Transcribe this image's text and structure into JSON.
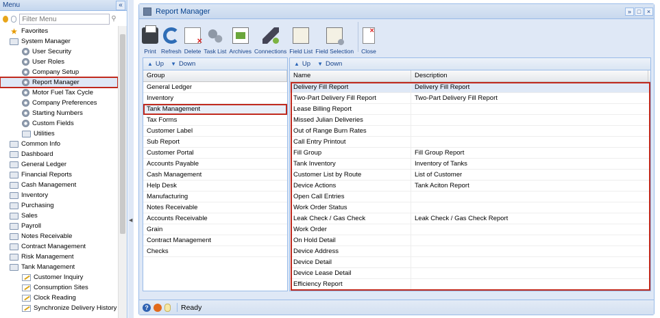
{
  "sidebar": {
    "title": "Menu",
    "collapse_glyph": "«",
    "filter_placeholder": "Filter Menu",
    "items": [
      {
        "label": "Favorites",
        "icon": "star-icon",
        "level": 0
      },
      {
        "label": "System Manager",
        "icon": "folder-icon",
        "level": 0
      },
      {
        "label": "User Security",
        "icon": "gear-icon",
        "level": 1
      },
      {
        "label": "User Roles",
        "icon": "gear-icon",
        "level": 1
      },
      {
        "label": "Company Setup",
        "icon": "gear-icon",
        "level": 1
      },
      {
        "label": "Report Manager",
        "icon": "gear-icon",
        "level": 1,
        "selected": true
      },
      {
        "label": "Motor Fuel Tax Cycle",
        "icon": "gear-icon",
        "level": 1
      },
      {
        "label": "Company Preferences",
        "icon": "gear-icon",
        "level": 1
      },
      {
        "label": "Starting Numbers",
        "icon": "gear-icon",
        "level": 1
      },
      {
        "label": "Custom Fields",
        "icon": "gear-icon",
        "level": 1
      },
      {
        "label": "Utilities",
        "icon": "folder-icon",
        "level": 1
      },
      {
        "label": "Common Info",
        "icon": "folder-icon",
        "level": 0
      },
      {
        "label": "Dashboard",
        "icon": "folder-icon",
        "level": 0
      },
      {
        "label": "General Ledger",
        "icon": "folder-icon",
        "level": 0
      },
      {
        "label": "Financial Reports",
        "icon": "folder-icon",
        "level": 0
      },
      {
        "label": "Cash Management",
        "icon": "folder-icon",
        "level": 0
      },
      {
        "label": "Inventory",
        "icon": "folder-icon",
        "level": 0
      },
      {
        "label": "Purchasing",
        "icon": "folder-icon",
        "level": 0
      },
      {
        "label": "Sales",
        "icon": "folder-icon",
        "level": 0
      },
      {
        "label": "Payroll",
        "icon": "folder-icon",
        "level": 0
      },
      {
        "label": "Notes Receivable",
        "icon": "folder-icon",
        "level": 0
      },
      {
        "label": "Contract Management",
        "icon": "folder-icon",
        "level": 0
      },
      {
        "label": "Risk Management",
        "icon": "folder-icon",
        "level": 0
      },
      {
        "label": "Tank Management",
        "icon": "folder-icon",
        "level": 0
      },
      {
        "label": "Customer Inquiry",
        "icon": "pencil-icon",
        "level": 1
      },
      {
        "label": "Consumption Sites",
        "icon": "pencil-icon",
        "level": 1
      },
      {
        "label": "Clock Reading",
        "icon": "pencil-icon",
        "level": 1
      },
      {
        "label": "Synchronize Delivery History",
        "icon": "pencil-icon",
        "level": 1
      }
    ]
  },
  "window": {
    "title": "Report Manager",
    "controls": [
      "»",
      "□",
      "×"
    ]
  },
  "toolbar": [
    {
      "label": "Print",
      "icon": "printer-icon",
      "css": "printer"
    },
    {
      "label": "Refresh",
      "icon": "refresh-icon",
      "css": "refresh"
    },
    {
      "label": "Delete",
      "icon": "delete-icon",
      "css": "doc-del"
    },
    {
      "label": "Task List",
      "icon": "task-list-icon",
      "css": "gears"
    },
    {
      "label": "Archives",
      "icon": "archives-icon",
      "css": "archive"
    },
    {
      "label": "Connections",
      "icon": "connections-icon",
      "css": "plug"
    },
    {
      "label": "Field List",
      "icon": "field-list-icon",
      "css": "fieldlist"
    },
    {
      "label": "Field Selection",
      "icon": "field-selection-icon",
      "css": "fieldsel"
    },
    {
      "label": "Close",
      "icon": "close-icon",
      "css": "close-doc",
      "separated": true
    }
  ],
  "grid_toolbar": {
    "up": "Up",
    "down": "Down",
    "up_glyph": "▲",
    "down_glyph": "▼"
  },
  "group_grid": {
    "header": "Group",
    "rows": [
      "General Ledger",
      "Inventory",
      "Tank Management",
      "Tax Forms",
      "Customer Label",
      "Sub Report",
      "Customer Portal",
      "Accounts Payable",
      "Cash Management",
      "Help Desk",
      "Manufacturing",
      "Notes Receivable",
      "Accounts Receivable",
      "Grain",
      "Contract Management",
      "Checks"
    ],
    "selected": "Tank Management"
  },
  "report_grid": {
    "headers": {
      "name": "Name",
      "description": "Description"
    },
    "rows": [
      {
        "name": "Delivery Fill Report",
        "description": "Delivery Fill Report"
      },
      {
        "name": "Two-Part Delivery Fill Report",
        "description": "Two-Part Delivery Fill Report"
      },
      {
        "name": "Lease Billing Report",
        "description": ""
      },
      {
        "name": "Missed Julian Deliveries",
        "description": ""
      },
      {
        "name": "Out of Range Burn Rates",
        "description": ""
      },
      {
        "name": "Call Entry Printout",
        "description": ""
      },
      {
        "name": "Fill Group",
        "description": "Fill Group Report"
      },
      {
        "name": "Tank Inventory",
        "description": "Inventory of Tanks"
      },
      {
        "name": "Customer List by Route",
        "description": "List of Customer"
      },
      {
        "name": "Device Actions",
        "description": "Tank Aciton Report"
      },
      {
        "name": "Open Call Entries",
        "description": ""
      },
      {
        "name": "Work Order Status",
        "description": ""
      },
      {
        "name": "Leak Check / Gas Check",
        "description": "Leak Check / Gas Check Report"
      },
      {
        "name": "Work Order",
        "description": ""
      },
      {
        "name": "On Hold Detail",
        "description": ""
      },
      {
        "name": "Device Address",
        "description": ""
      },
      {
        "name": "Device Detail",
        "description": ""
      },
      {
        "name": "Device Lease Detail",
        "description": ""
      },
      {
        "name": "Efficiency Report",
        "description": ""
      }
    ]
  },
  "statusbar": {
    "status": "Ready",
    "help_glyph": "?"
  },
  "colors": {
    "accent": "#15428b",
    "highlight_border": "#c0281c",
    "panel_bg": "#dfe8f6"
  }
}
